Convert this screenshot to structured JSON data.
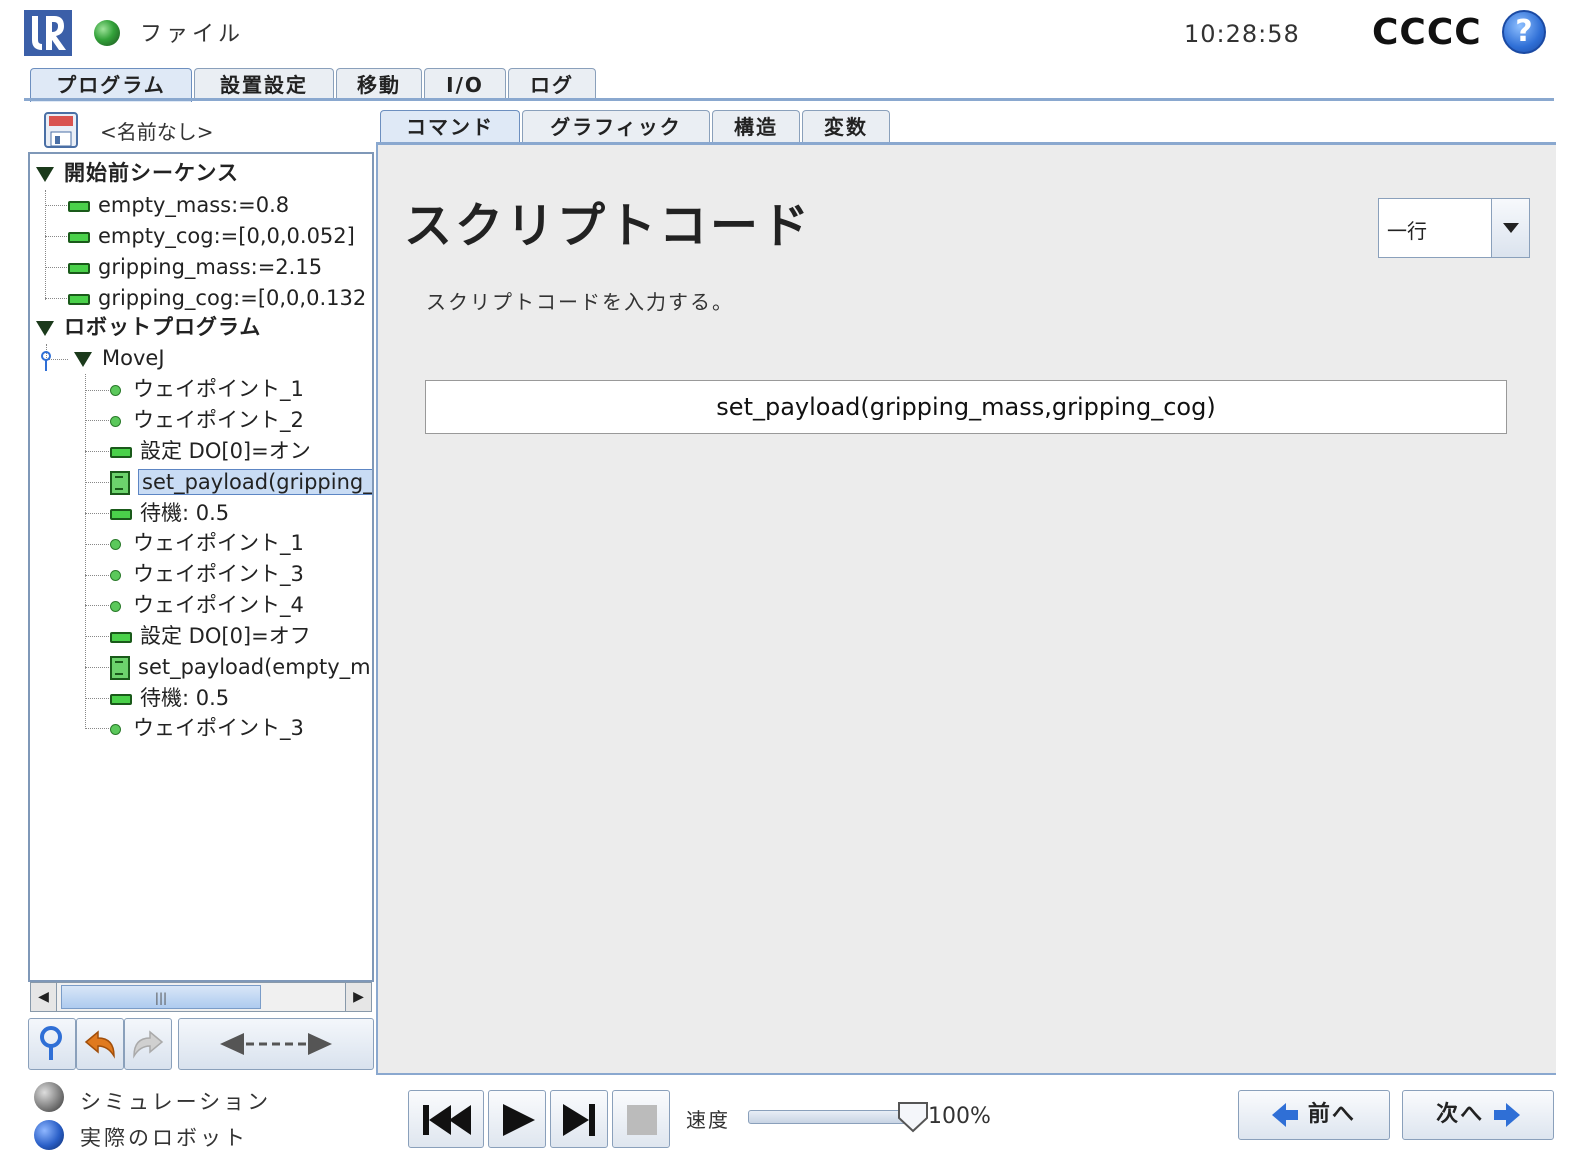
{
  "header": {
    "file_menu": "ファイル",
    "clock": "10:28:58",
    "robot_name": "CCCC",
    "help_symbol": "?"
  },
  "main_tabs": [
    {
      "label": "プログラム",
      "active": true
    },
    {
      "label": "設置設定",
      "active": false
    },
    {
      "label": "移動",
      "active": false
    },
    {
      "label": "I/O",
      "active": false
    },
    {
      "label": "ログ",
      "active": false
    }
  ],
  "left_panel": {
    "program_name": "<名前なし>",
    "tree": [
      {
        "label": "開始前シーケンス",
        "kind": "section"
      },
      {
        "label": "empty_mass:=0.8",
        "kind": "assign"
      },
      {
        "label": "empty_cog:=[0,0,0.052]",
        "kind": "assign"
      },
      {
        "label": "gripping_mass:=2.15",
        "kind": "assign"
      },
      {
        "label": "gripping_cog:=[0,0,0.132",
        "kind": "assign"
      },
      {
        "label": "ロボットプログラム",
        "kind": "section"
      },
      {
        "label": "MoveJ",
        "kind": "move"
      },
      {
        "label": "ウェイポイント_1",
        "kind": "waypoint"
      },
      {
        "label": "ウェイポイント_2",
        "kind": "waypoint"
      },
      {
        "label": "設定 DO[0]=オン",
        "kind": "set"
      },
      {
        "label": "set_payload(gripping_",
        "kind": "script",
        "selected": true
      },
      {
        "label": "待機: 0.5",
        "kind": "wait"
      },
      {
        "label": "ウェイポイント_1",
        "kind": "waypoint"
      },
      {
        "label": "ウェイポイント_3",
        "kind": "waypoint"
      },
      {
        "label": "ウェイポイント_4",
        "kind": "waypoint"
      },
      {
        "label": "設定 DO[0]=オフ",
        "kind": "set"
      },
      {
        "label": "set_payload(empty_m",
        "kind": "script"
      },
      {
        "label": "待機: 0.5",
        "kind": "wait"
      },
      {
        "label": "ウェイポイント_3",
        "kind": "waypoint"
      }
    ],
    "scroll_thumb_glyph": "|||"
  },
  "sub_tabs": [
    {
      "label": "コマンド",
      "active": true
    },
    {
      "label": "グラフィック",
      "active": false
    },
    {
      "label": "構造",
      "active": false
    },
    {
      "label": "変数",
      "active": false
    }
  ],
  "script_panel": {
    "title": "スクリプトコード",
    "description": "スクリプトコードを入力する。",
    "mode_value": "一行",
    "code": "set_payload(gripping_mass,gripping_cog)"
  },
  "footer": {
    "simulation_label": "シミュレーション",
    "real_robot_label": "実際のロボット",
    "speed_label": "速度",
    "speed_value": "100%",
    "speed_fraction": 1.0,
    "prev_label": "前へ",
    "next_label": "次へ"
  },
  "colors": {
    "accent_blue": "#2f6fd6",
    "tab_border": "#8aa8cf",
    "tree_green": "#4ad14a",
    "content_bg": "#ececec"
  }
}
